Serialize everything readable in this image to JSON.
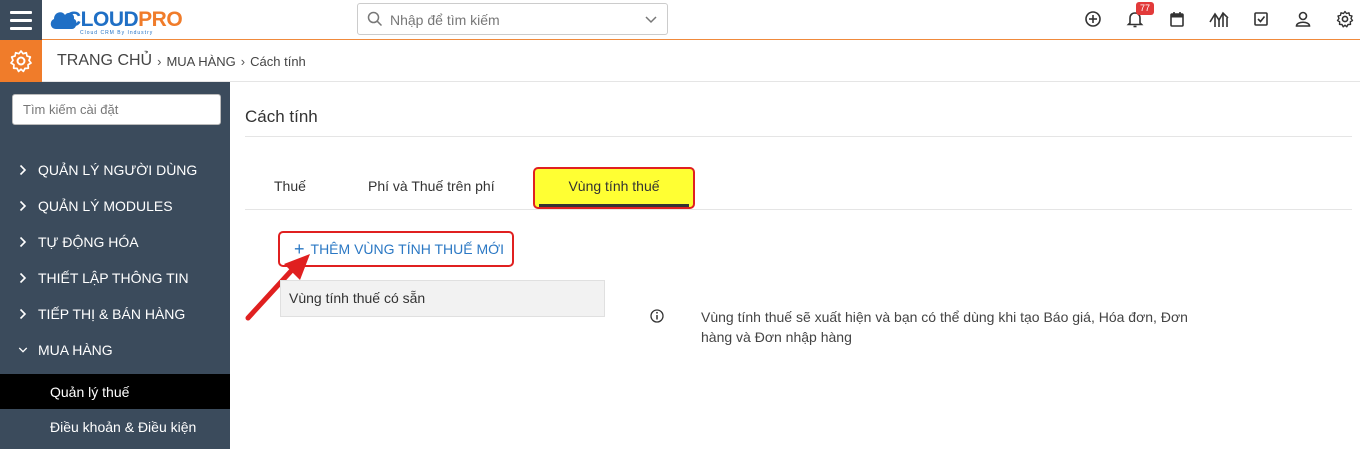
{
  "header": {
    "logo_part1": "CLOUD",
    "logo_part2": "PRO",
    "logo_tagline": "Cloud CRM By Industry",
    "search_placeholder": "Nhập để tìm kiếm",
    "notification_count": "77",
    "icons": [
      "plus-circle-icon",
      "bell-icon",
      "calendar-icon",
      "chart-icon",
      "checkbox-icon",
      "user-icon",
      "gear-icon"
    ]
  },
  "breadcrumb": {
    "home": "TRANG CHỦ",
    "section": "MUA HÀNG",
    "current": "Cách tính"
  },
  "sidebar": {
    "search_placeholder": "Tìm kiếm cài đặt",
    "items": [
      {
        "label": "QUẢN LÝ NGƯỜI DÙNG",
        "expanded": false
      },
      {
        "label": "QUẢN LÝ MODULES",
        "expanded": false
      },
      {
        "label": "TỰ ĐỘNG HÓA",
        "expanded": false
      },
      {
        "label": "THIẾT LẬP THÔNG TIN",
        "expanded": false
      },
      {
        "label": "TIẾP THỊ & BÁN HÀNG",
        "expanded": false
      },
      {
        "label": "MUA HÀNG",
        "expanded": true
      }
    ],
    "subitems": [
      {
        "label": "Quản lý thuế",
        "active": true
      },
      {
        "label": "Điều khoản & Điều kiện",
        "active": false
      }
    ]
  },
  "main": {
    "title": "Cách tính",
    "tabs": [
      {
        "label": "Thuế"
      },
      {
        "label": "Phí và Thuế trên phí"
      },
      {
        "label": "Vùng tính thuế",
        "active": true
      }
    ],
    "add_button": "THÊM VÙNG TÍNH THUẾ MỚI",
    "available_label": "Vùng tính thuế có sẵn",
    "info_text": "Vùng tính thuế sẽ xuất hiện và bạn có thể dùng khi tạo Báo giá, Hóa đơn, Đơn hàng và Đơn nhập hàng"
  },
  "colors": {
    "accent_orange": "#f07c2a",
    "sidebar_bg": "#3b4b5c",
    "highlight_red": "#e02020",
    "highlight_yellow": "#ffff33",
    "link_blue": "#2b78c4"
  }
}
